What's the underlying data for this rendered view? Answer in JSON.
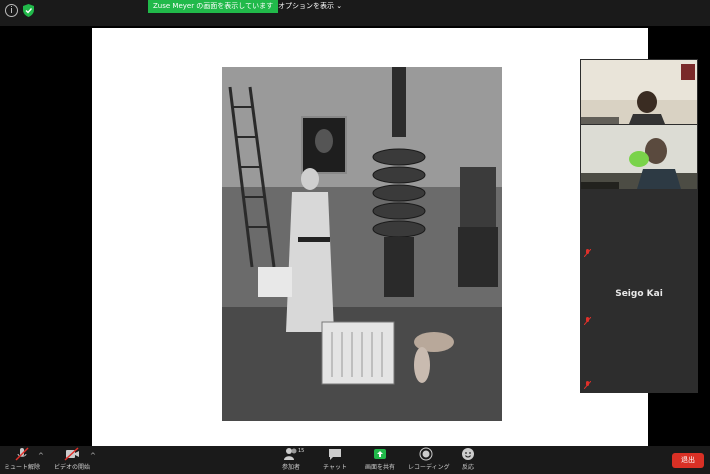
{
  "share_banner": {
    "text": "Zuse Meyer の画面を表示しています"
  },
  "view_options": {
    "label": "オプションを表示 ⌄"
  },
  "gallery": {
    "participants": [
      {
        "name": "",
        "name_label": ""
      },
      {
        "name": "",
        "name_label": ""
      },
      {
        "name": "",
        "name_label": ""
      },
      {
        "name": "Seigo Kai",
        "name_label": "Seigo Kai"
      },
      {
        "name": "",
        "name_label": ""
      }
    ]
  },
  "toolbar": {
    "mute_label": "ミュート解除",
    "video_label": "ビデオの開始",
    "participants_label": "参加者",
    "participants_count": "15",
    "chat_label": "チャット",
    "share_label": "画面を共有",
    "record_label": "レコーディング",
    "reactions_label": "反応",
    "end_label": "退出"
  },
  "colors": {
    "share_green": "#21b94a",
    "end_red": "#d93025",
    "muted_red": "#e0302a",
    "bar": "#1a1a1a"
  }
}
